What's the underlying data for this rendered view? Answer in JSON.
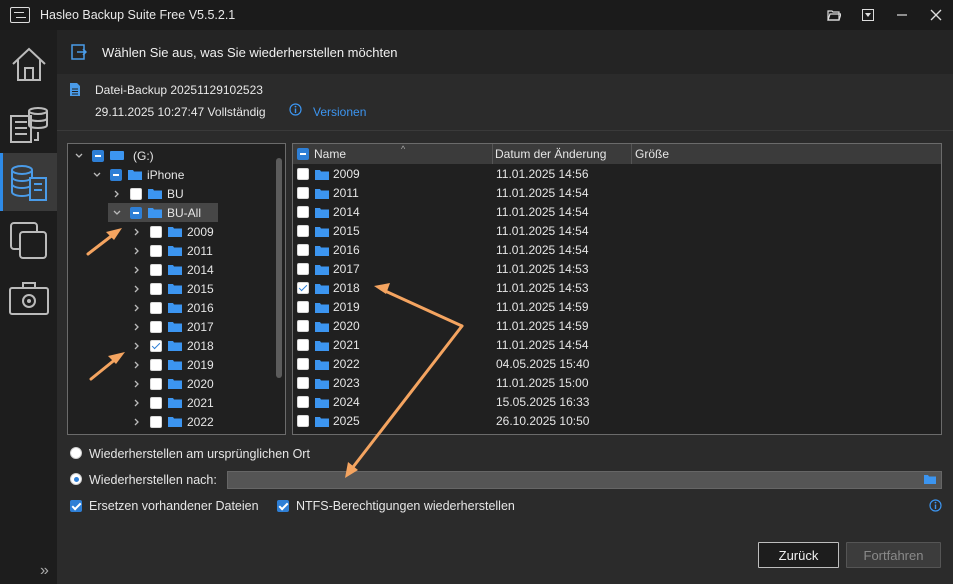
{
  "app": {
    "title": "Hasleo Backup Suite Free V5.5.2.1"
  },
  "header": {
    "title": "Wählen Sie aus, was Sie wiederherstellen möchten"
  },
  "backup": {
    "name": "Datei-Backup 20251129102523",
    "date_status": "29.11.2025 10:27:47 Vollständig",
    "versions_link": "Versionen"
  },
  "tree": {
    "drive": "(G:)",
    "iphone": "iPhone",
    "bu": "BU",
    "bu_all": "BU-All",
    "years": [
      "2009",
      "2011",
      "2014",
      "2015",
      "2016",
      "2017",
      "2018",
      "2019",
      "2020",
      "2021",
      "2022"
    ],
    "checked_year": "2018"
  },
  "list": {
    "columns": {
      "name": "Name",
      "date": "Datum der Änderung",
      "size": "Größe"
    },
    "rows": [
      {
        "name": "2009",
        "date": "11.01.2025 14:56",
        "checked": false
      },
      {
        "name": "2011",
        "date": "11.01.2025 14:54",
        "checked": false
      },
      {
        "name": "2014",
        "date": "11.01.2025 14:54",
        "checked": false
      },
      {
        "name": "2015",
        "date": "11.01.2025 14:54",
        "checked": false
      },
      {
        "name": "2016",
        "date": "11.01.2025 14:54",
        "checked": false
      },
      {
        "name": "2017",
        "date": "11.01.2025 14:53",
        "checked": false
      },
      {
        "name": "2018",
        "date": "11.01.2025 14:53",
        "checked": true
      },
      {
        "name": "2019",
        "date": "11.01.2025 14:59",
        "checked": false
      },
      {
        "name": "2020",
        "date": "11.01.2025 14:59",
        "checked": false
      },
      {
        "name": "2021",
        "date": "11.01.2025 14:54",
        "checked": false
      },
      {
        "name": "2022",
        "date": "04.05.2025 15:40",
        "checked": false
      },
      {
        "name": "2023",
        "date": "11.01.2025 15:00",
        "checked": false
      },
      {
        "name": "2024",
        "date": "15.05.2025 16:33",
        "checked": false
      },
      {
        "name": "2025",
        "date": "26.10.2025 10:50",
        "checked": false
      }
    ]
  },
  "options": {
    "restore_original": "Wiederherstellen am ursprünglichen Ort",
    "restore_to": "Wiederherstellen nach:",
    "restore_to_value": "",
    "replace_existing": "Ersetzen vorhandener Dateien",
    "ntfs_permissions": "NTFS-Berechtigungen wiederherstellen",
    "selected_mode": "restore_to"
  },
  "buttons": {
    "back": "Zurück",
    "continue": "Fortfahren"
  },
  "colors": {
    "accent": "#2e7fd6",
    "link": "#3c95f0",
    "arrow": "#f4a460"
  }
}
